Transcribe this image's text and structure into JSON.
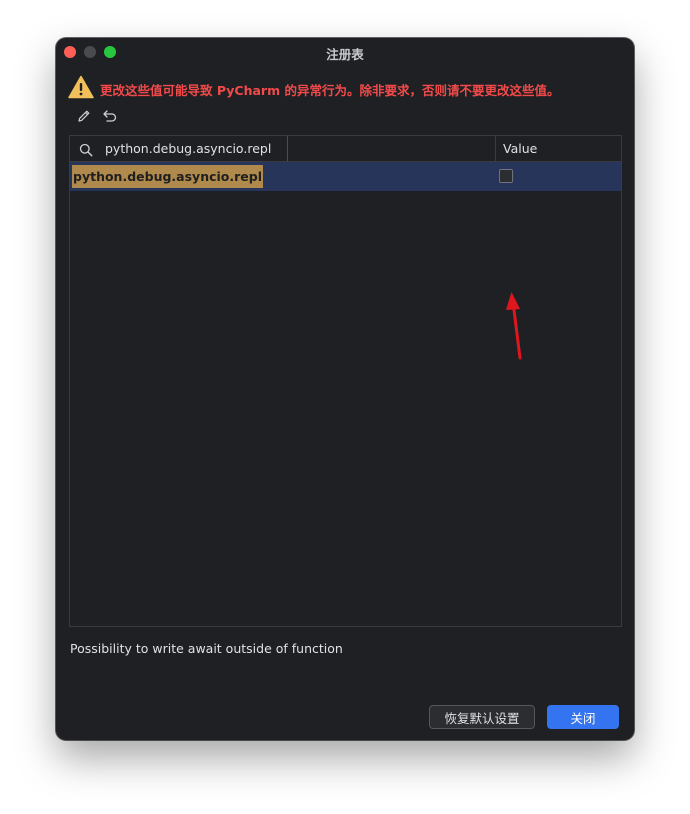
{
  "window": {
    "title": "注册表"
  },
  "warning": {
    "text": "更改这些值可能导致 PyCharm 的异常行为。除非要求，否则请不要更改这些值。",
    "color": "#f24a4a"
  },
  "toolbar": {
    "icons": [
      "edit-icon",
      "revert-icon"
    ]
  },
  "table": {
    "search": {
      "value": "python.debug.asyncio.repl"
    },
    "columns": {
      "value_header": "Value"
    },
    "rows": [
      {
        "key": "python.debug.asyncio.repl",
        "checked": false
      }
    ]
  },
  "description": "Possibility to write await outside of function",
  "buttons": {
    "restore_defaults": "恢复默认设置",
    "close": "关闭"
  },
  "colors": {
    "accent": "#3574f0",
    "selection": "#263559",
    "highlight": "#b08a4c",
    "annotation_arrow": "#e0161f"
  }
}
